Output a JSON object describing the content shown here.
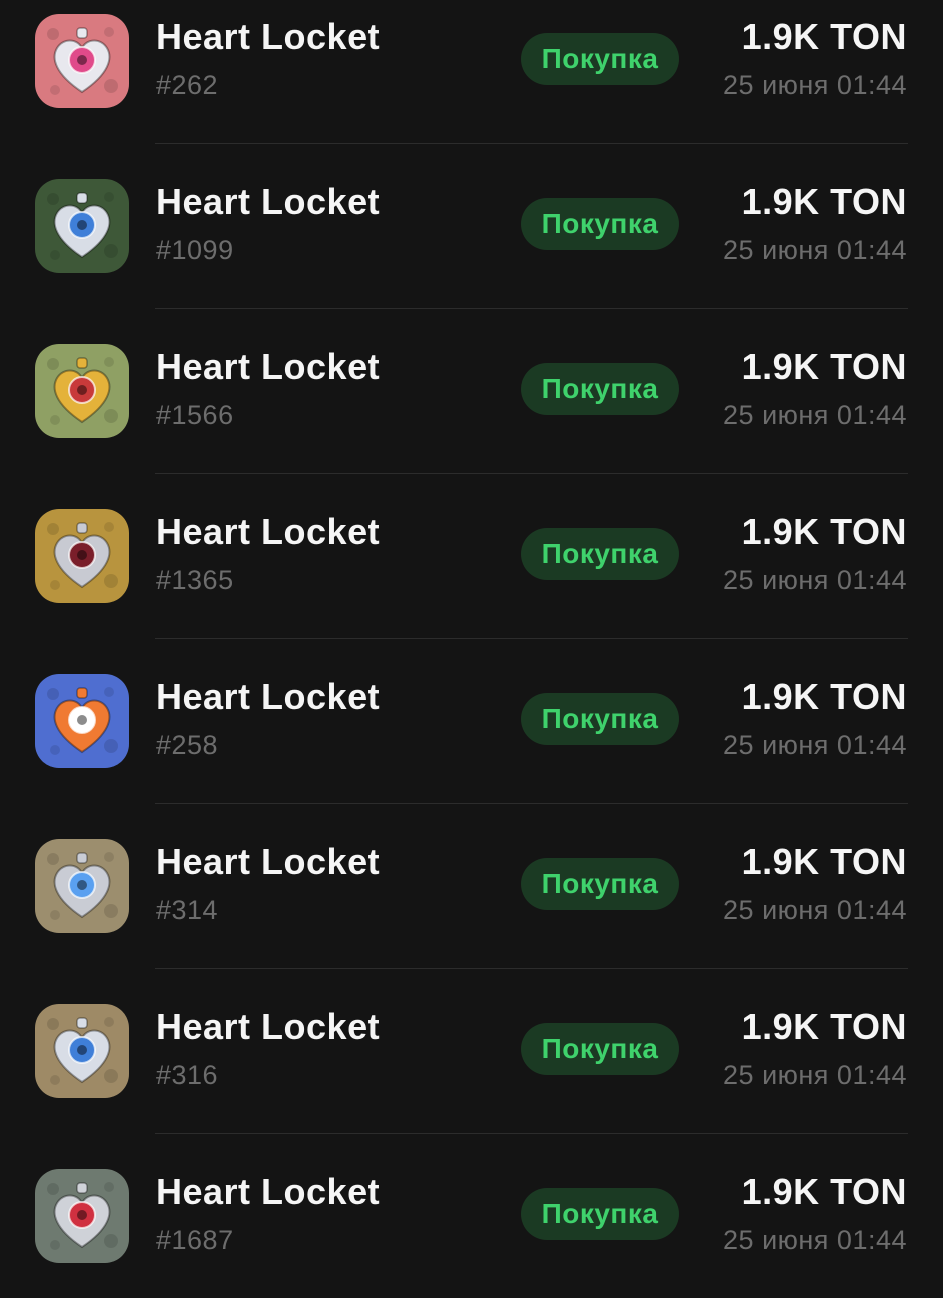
{
  "items": [
    {
      "title": "Heart Locket",
      "number": "#262",
      "action": "Покупка",
      "price": "1.9K TON",
      "date": "25 июня 01:44",
      "icon": "heart-locket-pink-icon",
      "bg": "#d97a80",
      "accent": "#e8e8ee",
      "core": "#e04a8a"
    },
    {
      "title": "Heart Locket",
      "number": "#1099",
      "action": "Покупка",
      "price": "1.9K TON",
      "date": "25 июня 01:44",
      "icon": "heart-locket-dark-green-icon",
      "bg": "#3e5838",
      "accent": "#d8dde6",
      "core": "#3f7fd8"
    },
    {
      "title": "Heart Locket",
      "number": "#1566",
      "action": "Покупка",
      "price": "1.9K TON",
      "date": "25 июня 01:44",
      "icon": "heart-locket-gold-compass-icon",
      "bg": "#8fa064",
      "accent": "#e4b23a",
      "core": "#c83a3a"
    },
    {
      "title": "Heart Locket",
      "number": "#1365",
      "action": "Покупка",
      "price": "1.9K TON",
      "date": "25 июня 01:44",
      "icon": "heart-locket-eye-icon",
      "bg": "#b8943e",
      "accent": "#c8cad2",
      "core": "#7a1e2a"
    },
    {
      "title": "Heart Locket",
      "number": "#258",
      "action": "Покупка",
      "price": "1.9K TON",
      "date": "25 июня 01:44",
      "icon": "heart-locket-pizza-icon",
      "bg": "#4f6ed0",
      "accent": "#f07a32",
      "core": "#ffffff"
    },
    {
      "title": "Heart Locket",
      "number": "#314",
      "action": "Покупка",
      "price": "1.9K TON",
      "date": "25 июня 01:44",
      "icon": "heart-locket-blue-grill-icon",
      "bg": "#9c8e6e",
      "accent": "#c9ccd4",
      "core": "#5aa0f0"
    },
    {
      "title": "Heart Locket",
      "number": "#316",
      "action": "Покупка",
      "price": "1.9K TON",
      "date": "25 июня 01:44",
      "icon": "heart-locket-tan-icon",
      "bg": "#9e8a66",
      "accent": "#d8dde6",
      "core": "#3f7fd8"
    },
    {
      "title": "Heart Locket",
      "number": "#1687",
      "action": "Покупка",
      "price": "1.9K TON",
      "date": "25 июня 01:44",
      "icon": "heart-locket-red-icon",
      "bg": "#6e7a70",
      "accent": "#cfd2d8",
      "core": "#d03040"
    }
  ],
  "colors": {
    "background": "#141414",
    "badge_bg": "#1b3a23",
    "badge_text": "#3fd26c",
    "secondary_text": "#6d6d6d"
  }
}
